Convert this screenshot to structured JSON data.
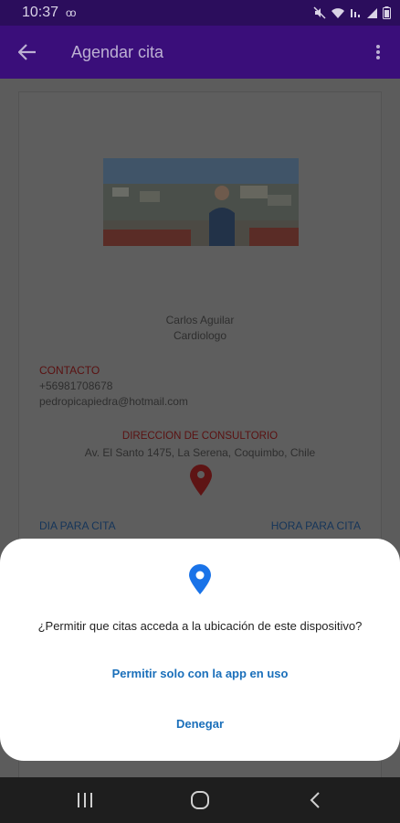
{
  "status_bar": {
    "time": "10:37",
    "voicemail": "oo",
    "icons": [
      "mute-icon",
      "wifi-icon",
      "lte-icon",
      "signal-icon",
      "battery-icon"
    ]
  },
  "app_bar": {
    "title": "Agendar cita",
    "icons": [
      "back-arrow-icon",
      "more-vertical-icon"
    ]
  },
  "profile": {
    "name": "Carlos Aguilar",
    "specialty": "Cardiologo"
  },
  "contact": {
    "heading": "CONTACTO",
    "phone": "+56981708678",
    "email": "pedropicapiedra@hotmail.com"
  },
  "office": {
    "heading": "DIRECCION DE CONSULTORIO",
    "address": "Av. El Santo 1475, La Serena, Coquimbo, Chile"
  },
  "appointment": {
    "day_label": "DIA PARA CITA",
    "hour_label": "HORA PARA CITA"
  },
  "dialog": {
    "message": "¿Permitir que citas acceda a la ubicación de este dispositivo?",
    "allow_label": "Permitir solo con la app en uso",
    "deny_label": "Denegar"
  },
  "colors": {
    "status_bar": "#2b0d5c",
    "app_bar": "#3a0e7a",
    "accent_red": "#c62828",
    "accent_blue": "#1a73e8",
    "dialog_link": "#1a6fba"
  },
  "nav_bar": {
    "icons": [
      "recent-apps-icon",
      "home-icon",
      "back-icon"
    ]
  }
}
